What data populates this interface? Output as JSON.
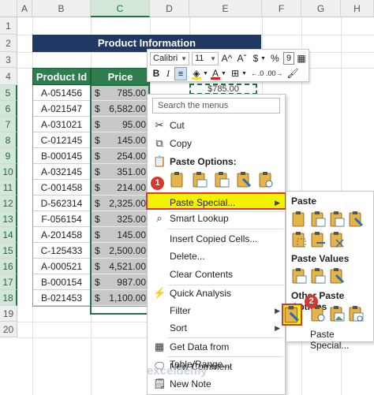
{
  "sheet": {
    "columns": [
      "A",
      "B",
      "C",
      "D",
      "E",
      "F",
      "G",
      "H"
    ],
    "rows": [
      "1",
      "2",
      "3",
      "4",
      "5",
      "6",
      "7",
      "8",
      "9",
      "10",
      "11",
      "12",
      "13",
      "14",
      "15",
      "16",
      "17",
      "18",
      "19",
      "20"
    ],
    "title": "Product Information",
    "header_id": "Product Id",
    "header_price": "Price",
    "currency": "$",
    "marquee_value": "$785.00",
    "data": [
      {
        "id": "A-051456",
        "price": "785.00"
      },
      {
        "id": "A-021547",
        "price": "6,582.00"
      },
      {
        "id": "A-031021",
        "price": "95.00"
      },
      {
        "id": "C-012145",
        "price": "145.00"
      },
      {
        "id": "B-000145",
        "price": "254.00"
      },
      {
        "id": "A-032145",
        "price": "351.00"
      },
      {
        "id": "C-001458",
        "price": "214.00"
      },
      {
        "id": "D-562314",
        "price": "2,325.00"
      },
      {
        "id": "F-056154",
        "price": "325.00"
      },
      {
        "id": "A-201458",
        "price": "145.00"
      },
      {
        "id": "C-125433",
        "price": "2,500.00"
      },
      {
        "id": "A-000521",
        "price": "4,521.00"
      },
      {
        "id": "B-000154",
        "price": "987.00"
      },
      {
        "id": "B-021453",
        "price": "1,100.00"
      }
    ]
  },
  "mini_toolbar": {
    "font": "Calibri",
    "size": "11",
    "grow_font": "A^",
    "shrink_font": "Aˇ",
    "currency": "$",
    "percent": "%",
    "comma": "9",
    "bold": "B",
    "italic": "I"
  },
  "context_menu": {
    "search_placeholder": "Search the menus",
    "cut": "Cut",
    "copy": "Copy",
    "paste_options": "Paste Options:",
    "paste_special": "Paste Special...",
    "smart_lookup": "Smart Lookup",
    "insert_copied": "Insert Copied Cells...",
    "delete": "Delete...",
    "clear_contents": "Clear Contents",
    "quick_analysis": "Quick Analysis",
    "filter": "Filter",
    "sort": "Sort",
    "get_data": "Get Data from Table/Range...",
    "new_comment": "New Comment",
    "new_note": "New Note"
  },
  "submenu": {
    "paste": "Paste",
    "paste_values": "Paste Values",
    "other_paste": "Other Paste Options",
    "paste_special": "Paste Special..."
  },
  "badges": {
    "one": "1",
    "two": "2"
  },
  "watermark": "exceldemy"
}
